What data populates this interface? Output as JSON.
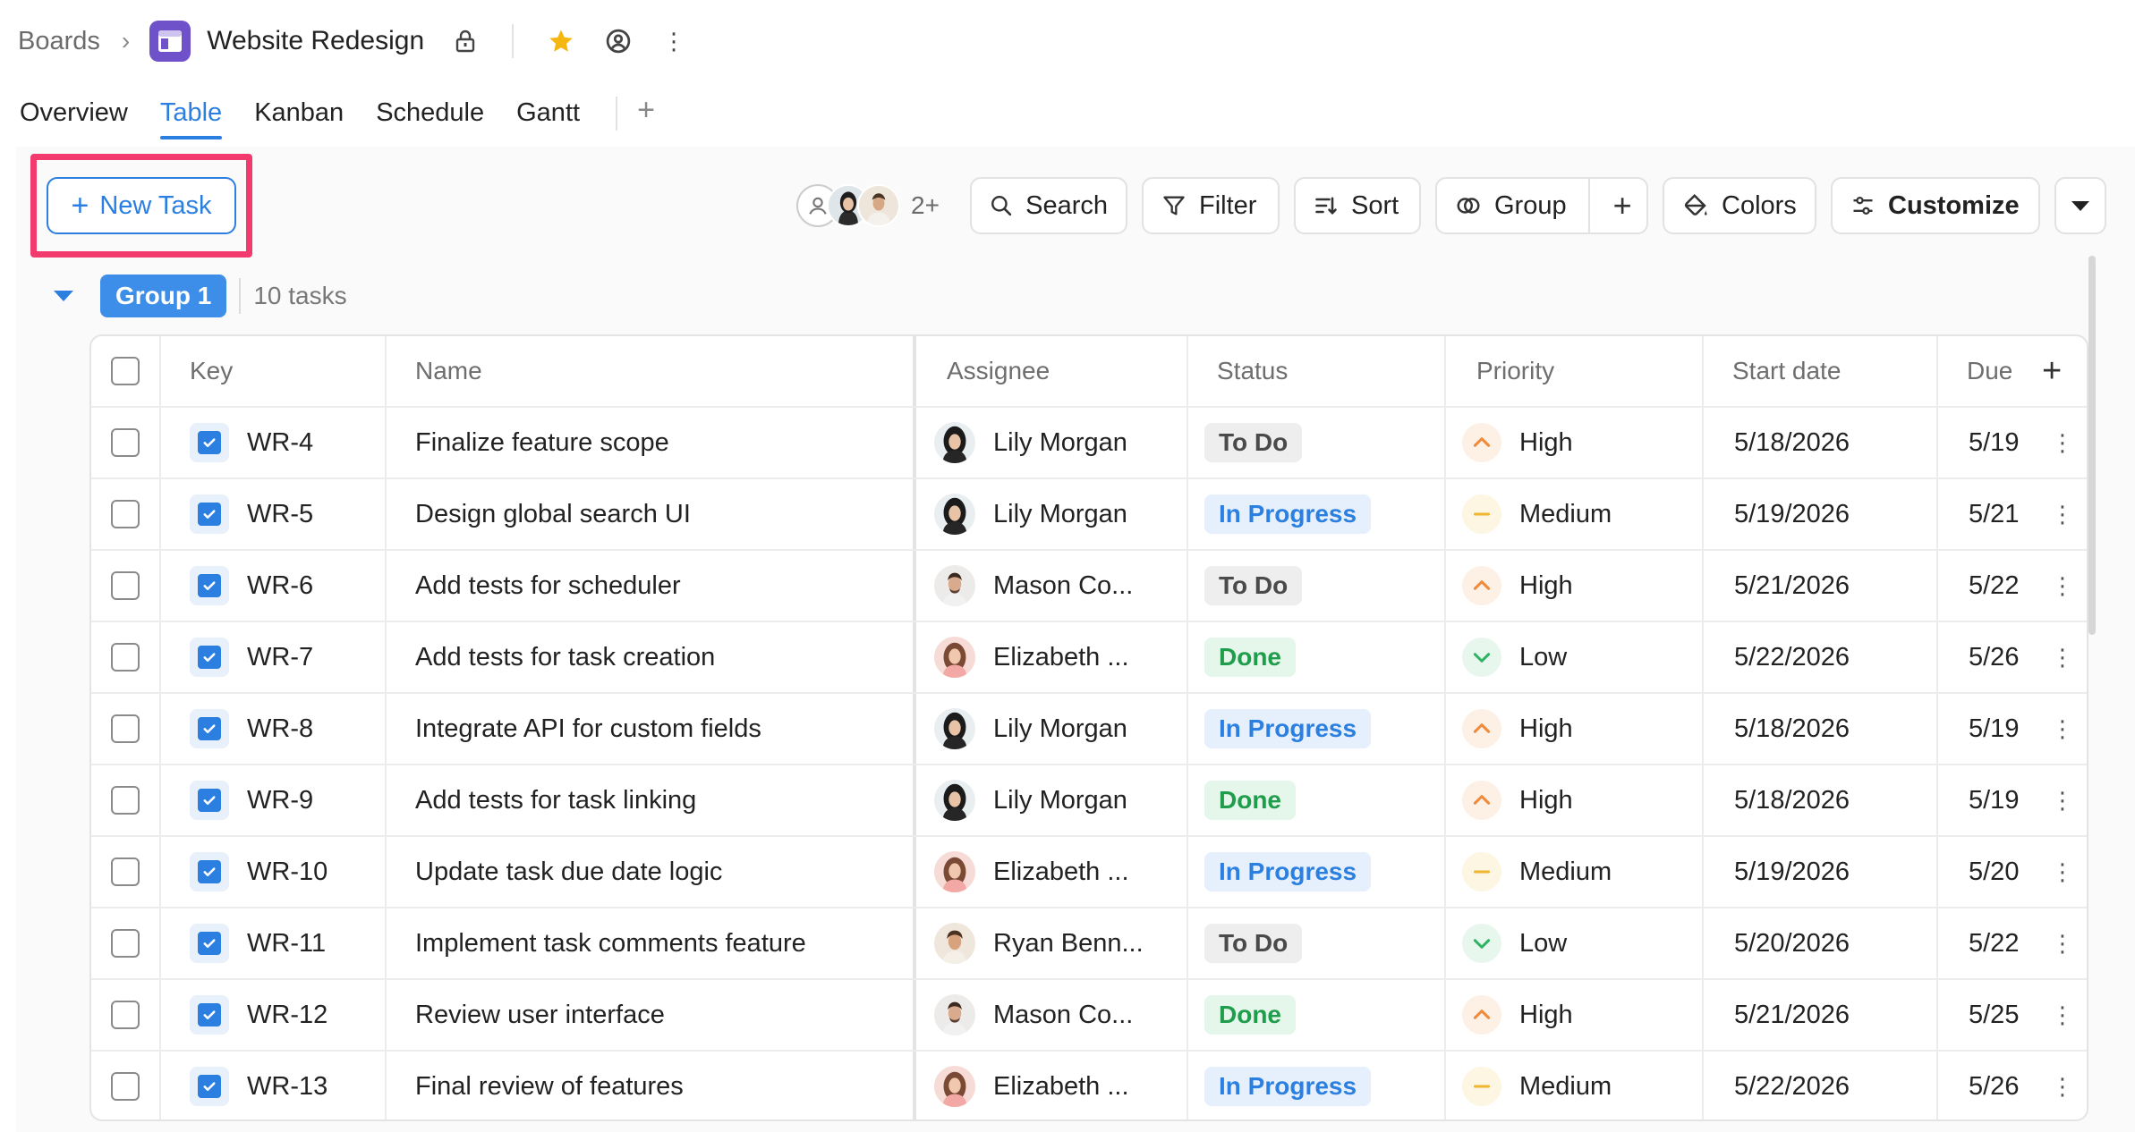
{
  "breadcrumb": {
    "root": "Boards",
    "board_title": "Website Redesign"
  },
  "tabs": [
    {
      "label": "Overview"
    },
    {
      "label": "Table",
      "active": true
    },
    {
      "label": "Kanban"
    },
    {
      "label": "Schedule"
    },
    {
      "label": "Gantt"
    }
  ],
  "toolbar": {
    "new_task": "New Task",
    "members_more": "2+",
    "search": "Search",
    "filter": "Filter",
    "sort": "Sort",
    "group": "Group",
    "colors": "Colors",
    "customize": "Customize"
  },
  "group": {
    "name": "Group 1",
    "count": "10 tasks"
  },
  "columns": {
    "key": "Key",
    "name": "Name",
    "assignee": "Assignee",
    "status": "Status",
    "priority": "Priority",
    "start": "Start date",
    "due": "Due"
  },
  "colors": {
    "accent": "#2b7fe0",
    "highlight": "#f23a6e",
    "status_todo_bg": "#eeeeee",
    "status_todo_fg": "#4a4a4a",
    "status_progress_bg": "#e6f0fd",
    "status_progress_fg": "#2b7fe0",
    "status_done_bg": "#e5f6ea",
    "status_done_fg": "#1f9d4c",
    "prio_high": "#f08a3c",
    "prio_medium": "#f1b533",
    "prio_low": "#2fb463"
  },
  "rows": [
    {
      "key": "WR-4",
      "name": "Finalize feature scope",
      "assignee": "Lily Morgan",
      "avatar": "lily",
      "status": "To Do",
      "priority": "High",
      "start": "5/18/2026",
      "due": "5/19"
    },
    {
      "key": "WR-5",
      "name": "Design global search UI",
      "assignee": "Lily Morgan",
      "avatar": "lily",
      "status": "In Progress",
      "priority": "Medium",
      "start": "5/19/2026",
      "due": "5/21"
    },
    {
      "key": "WR-6",
      "name": "Add tests for scheduler",
      "assignee": "Mason Co...",
      "avatar": "mason",
      "status": "To Do",
      "priority": "High",
      "start": "5/21/2026",
      "due": "5/22"
    },
    {
      "key": "WR-7",
      "name": "Add tests for task creation",
      "assignee": "Elizabeth ...",
      "avatar": "elizabeth",
      "status": "Done",
      "priority": "Low",
      "start": "5/22/2026",
      "due": "5/26"
    },
    {
      "key": "WR-8",
      "name": "Integrate API for custom fields",
      "assignee": "Lily Morgan",
      "avatar": "lily",
      "status": "In Progress",
      "priority": "High",
      "start": "5/18/2026",
      "due": "5/19"
    },
    {
      "key": "WR-9",
      "name": "Add tests for task linking",
      "assignee": "Lily Morgan",
      "avatar": "lily",
      "status": "Done",
      "priority": "High",
      "start": "5/18/2026",
      "due": "5/19"
    },
    {
      "key": "WR-10",
      "name": "Update task due date logic",
      "assignee": "Elizabeth ...",
      "avatar": "elizabeth",
      "status": "In Progress",
      "priority": "Medium",
      "start": "5/19/2026",
      "due": "5/20"
    },
    {
      "key": "WR-11",
      "name": "Implement task comments feature",
      "assignee": "Ryan Benn...",
      "avatar": "ryan",
      "status": "To Do",
      "priority": "Low",
      "start": "5/20/2026",
      "due": "5/22"
    },
    {
      "key": "WR-12",
      "name": "Review user interface",
      "assignee": "Mason Co...",
      "avatar": "mason",
      "status": "Done",
      "priority": "High",
      "start": "5/21/2026",
      "due": "5/25"
    },
    {
      "key": "WR-13",
      "name": "Final review of features",
      "assignee": "Elizabeth ...",
      "avatar": "elizabeth",
      "status": "In Progress",
      "priority": "Medium",
      "start": "5/22/2026",
      "due": "5/26"
    }
  ]
}
